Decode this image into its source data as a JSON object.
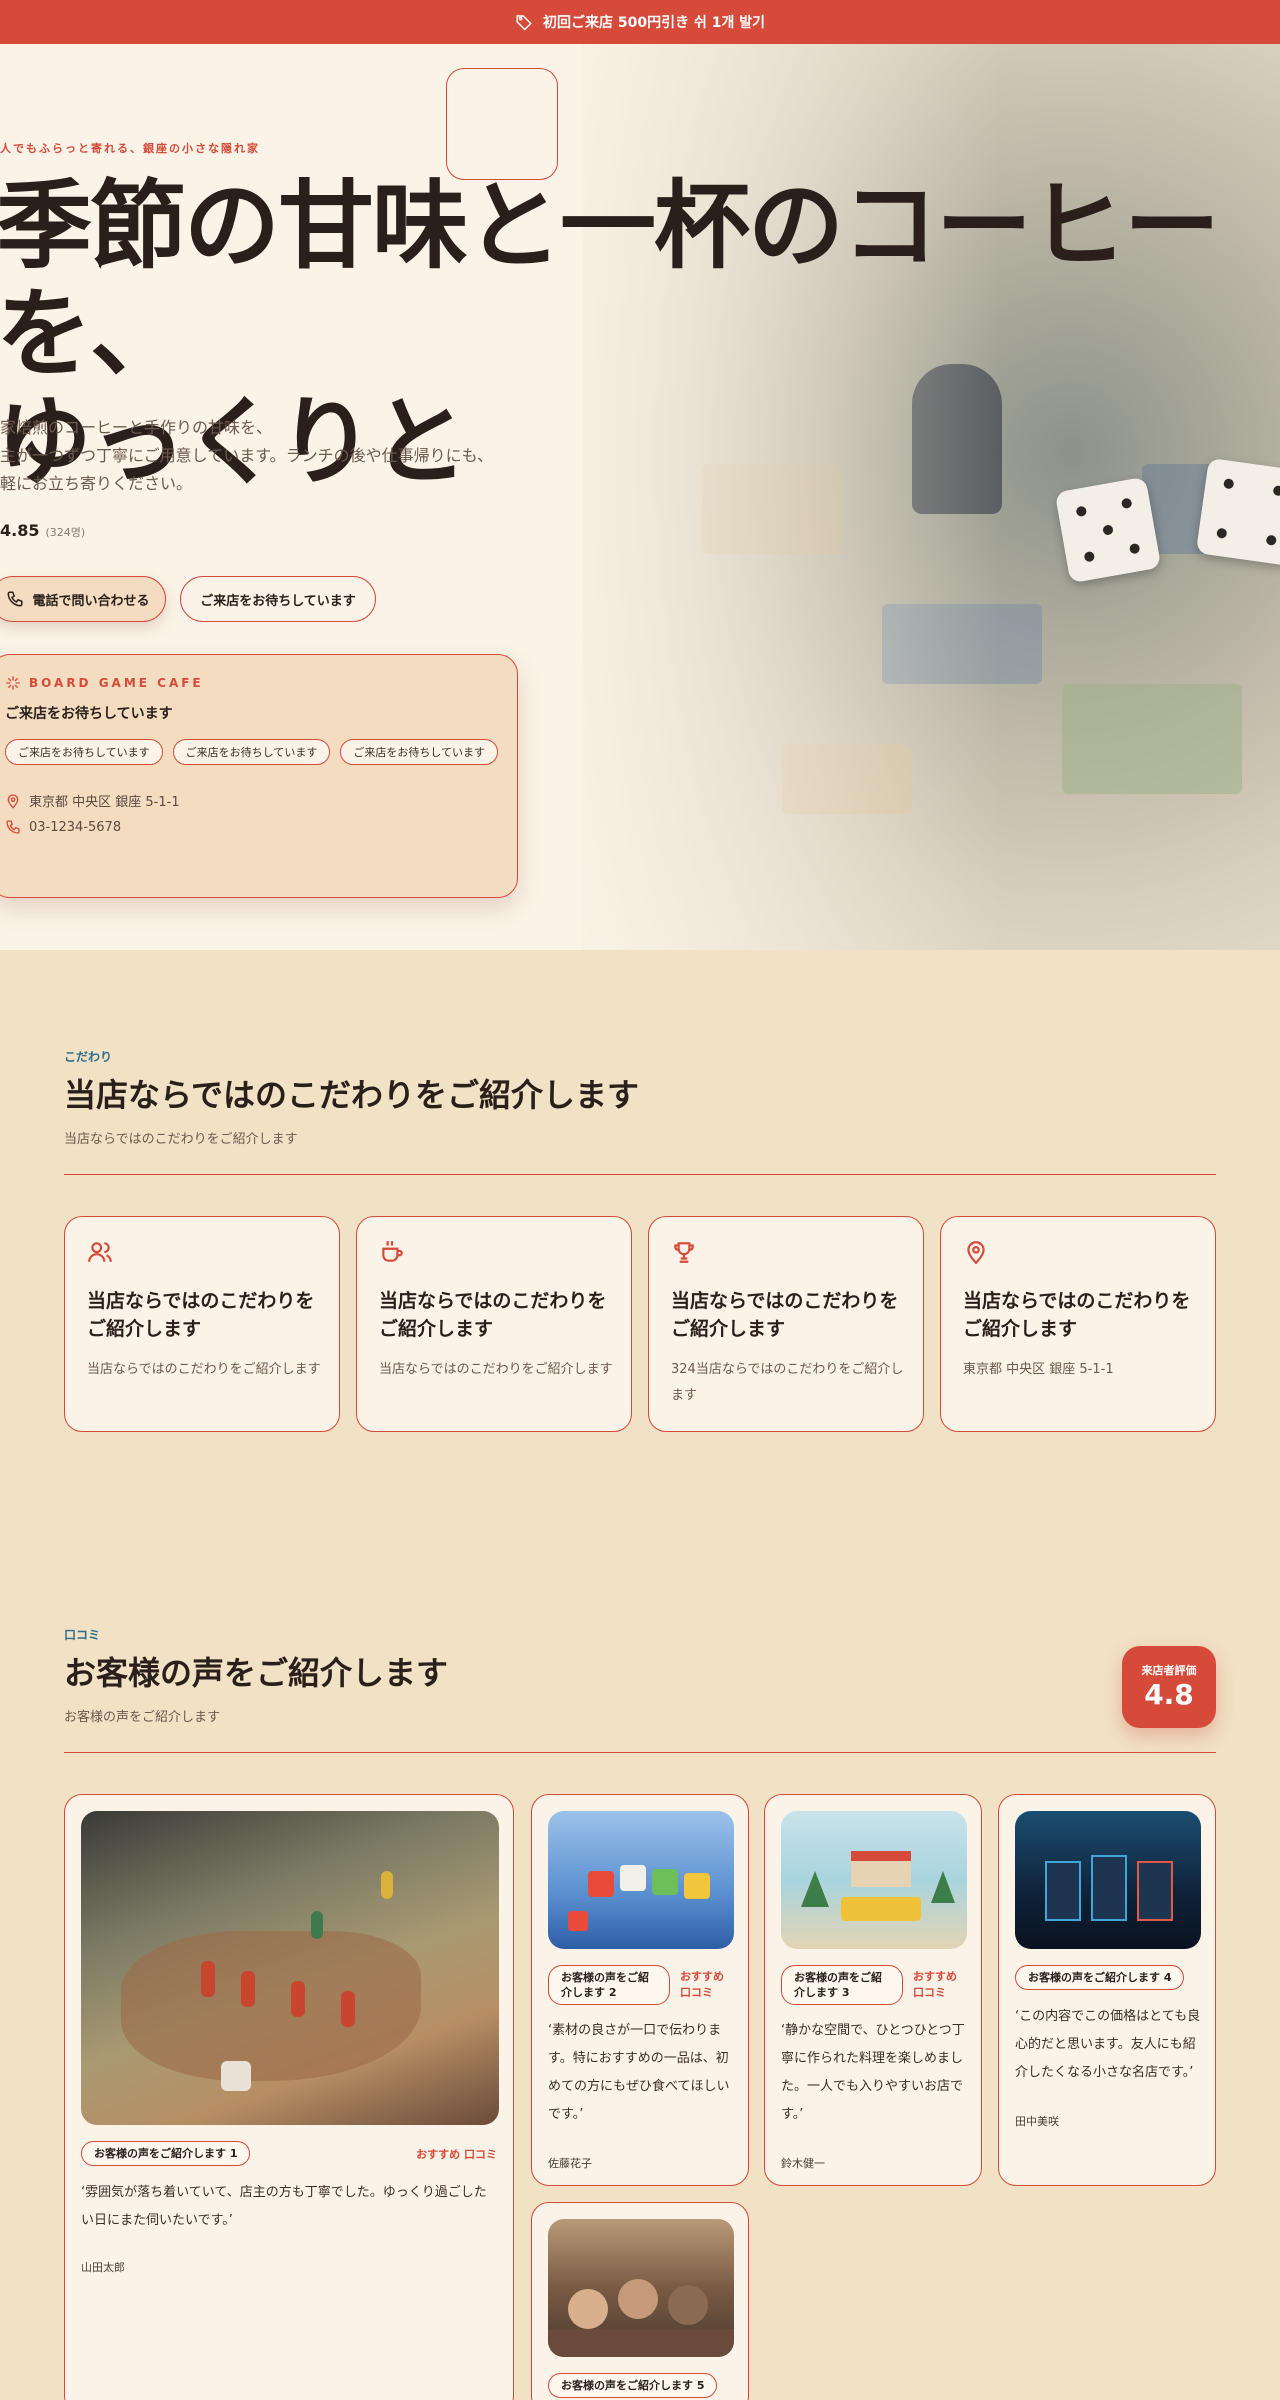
{
  "promo": {
    "text": "初回ご来店 500円引き 쉬 1개 발기"
  },
  "hero": {
    "eyebrow": "人でもふらっと寄れる、銀座の小さな隠れ家",
    "headline_line1": "季節の甘味と一杯のコーヒーを、",
    "headline_line2": "ゆっくりと",
    "lead_line1": "家焙煎のコーヒーと手作りの甘味を、",
    "lead_line2": "主が一つずつ丁寧にご用意しています。ランチの後や仕事帰りにも、",
    "lead_line3": "軽にお立ち寄りください。",
    "rating_value": "4.85",
    "rating_count": "(324명)",
    "call_button": "電話で問い合わせる",
    "visit_button": "ご来店をお待ちしています"
  },
  "info_card": {
    "brand": "BOARD GAME CAFE",
    "title": "ご来店をお待ちしています",
    "chips": [
      "ご来店をお待ちしています",
      "ご来店をお待ちしています",
      "ご来店をお待ちしています"
    ],
    "address": "東京都 中央区 銀座 5-1-1",
    "phone": "03-1234-5678"
  },
  "features": {
    "eyebrow": "こだわり",
    "title": "当店ならではのこだわりをご紹介します",
    "subtitle": "当店ならではのこだわりをご紹介します",
    "items": [
      {
        "icon": "users-icon",
        "title": "当店ならではのこだわりをご紹介します",
        "desc": "当店ならではのこだわりをご紹介します"
      },
      {
        "icon": "coffee-cup-icon",
        "title": "当店ならではのこだわりをご紹介します",
        "desc": "当店ならではのこだわりをご紹介します"
      },
      {
        "icon": "trophy-icon",
        "title": "当店ならではのこだわりをご紹介します",
        "desc": "324当店ならではのこだわりをご紹介します"
      },
      {
        "icon": "map-pin-icon",
        "title": "当店ならではのこだわりをご紹介します",
        "desc": "東京都 中央区 銀座 5-1-1"
      }
    ]
  },
  "reviews": {
    "eyebrow": "口コミ",
    "title": "お客様の声をご紹介します",
    "subtitle": "お客様の声をご紹介します",
    "score_label": "来店者評価",
    "score_value": "4.8",
    "items": [
      {
        "tag": "お客様の声をご紹介します 1",
        "rec": "おすすめ 口コミ",
        "quote": "‘雰囲気が落ち着いていて、店主の方も丁寧でした。ゆっくり過ごしたい日にまた伺いたいです。’",
        "author": "山田太郎"
      },
      {
        "tag": "お客様の声をご紹介します 2",
        "rec": "おすすめ 口コミ",
        "quote": "‘素材の良さが一口で伝わります。特におすすめの一品は、初めての方にもぜひ食べてほしいです。’",
        "author": "佐藤花子"
      },
      {
        "tag": "お客様の声をご紹介します 3",
        "rec": "おすすめ 口コミ",
        "quote": "‘静かな空間で、ひとつひとつ丁寧に作られた料理を楽しめました。一人でも入りやすいお店です。’",
        "author": "鈴木健一"
      },
      {
        "tag": "お客様の声をご紹介します 4",
        "rec": "",
        "quote": "‘この内容でこの価格はとても良心的だと思います。友人にも紹介したくなる小さな名店です。’",
        "author": "田中美咲"
      },
      {
        "tag": "お客様の声をご紹介します 5",
        "rec": "",
        "quote": "",
        "author": ""
      }
    ]
  },
  "colors": {
    "accent": "#d64a3a",
    "cream": "#fbf3e7",
    "sand": "#f1e1c5",
    "ink": "#2a1f1a"
  }
}
